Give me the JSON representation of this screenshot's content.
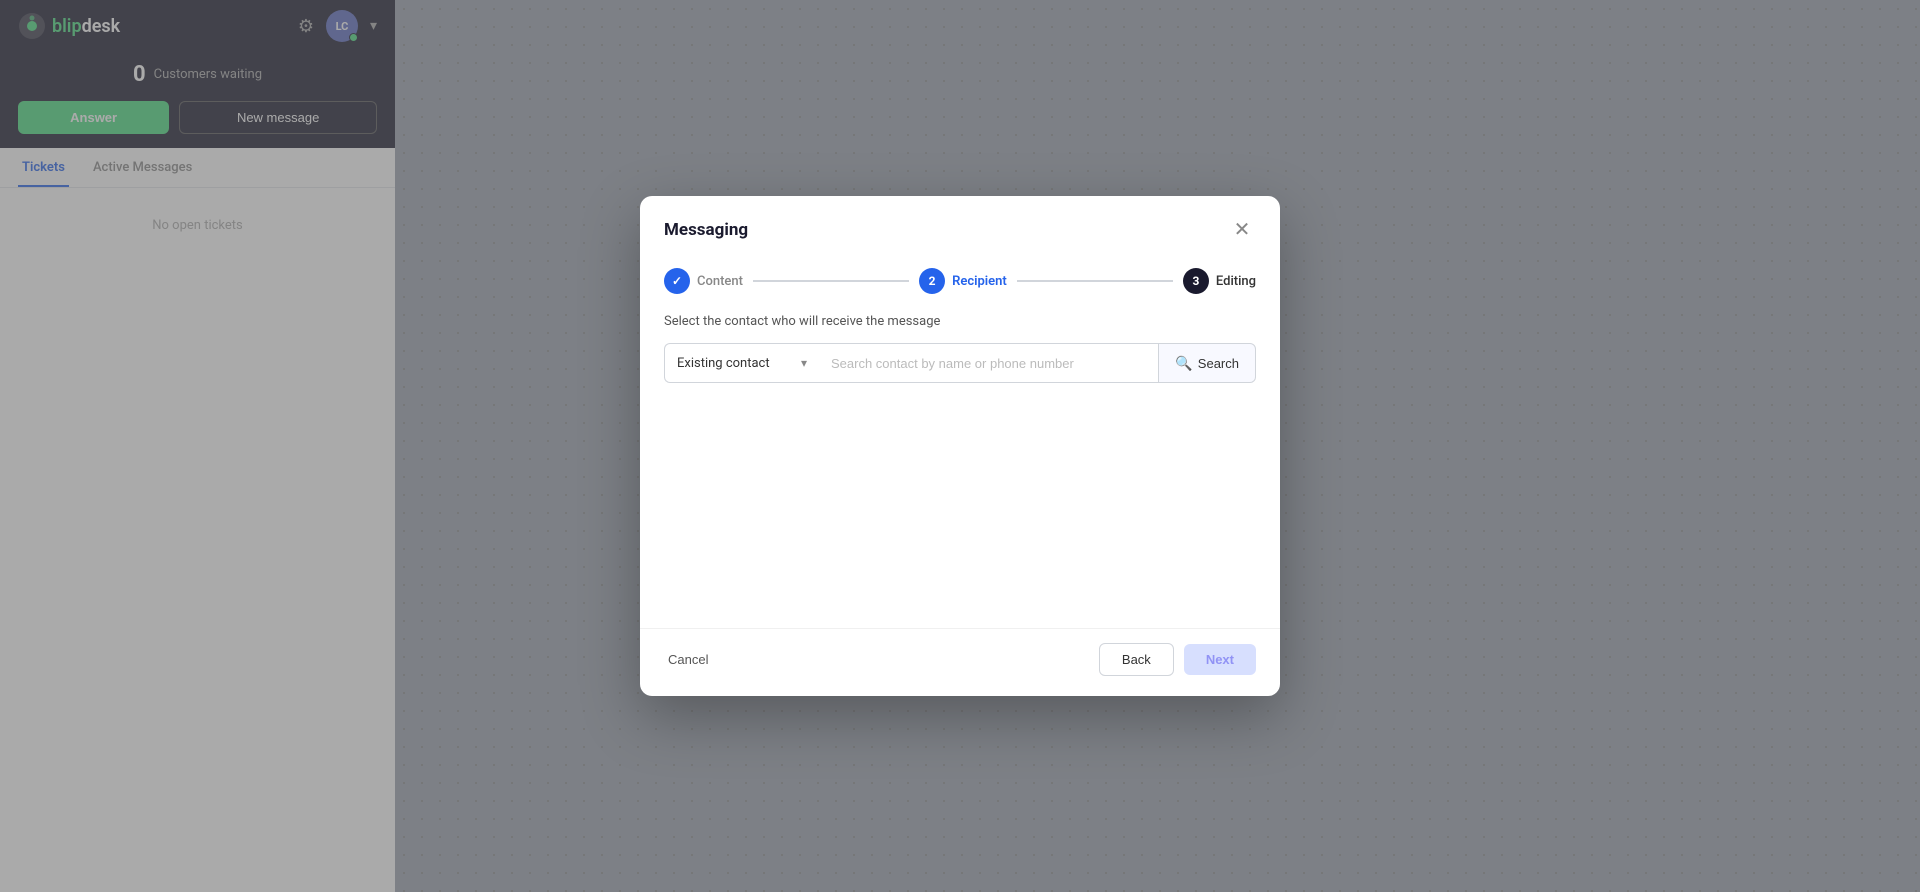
{
  "app": {
    "logo_text_1": "blip",
    "logo_text_2": "desk"
  },
  "header": {
    "avatar_initials": "LC",
    "gear_label": "settings"
  },
  "sidebar": {
    "customers_waiting_count": "0",
    "customers_waiting_label": "Customers waiting",
    "answer_button": "Answer",
    "new_message_button": "New message",
    "tabs": [
      {
        "id": "tickets",
        "label": "Tickets",
        "active": true
      },
      {
        "id": "active-messages",
        "label": "Active Messages",
        "active": false
      }
    ],
    "no_tickets_text": "No open tickets"
  },
  "modal": {
    "title": "Messaging",
    "steps": [
      {
        "id": "content",
        "number": "✓",
        "label": "Content",
        "state": "done"
      },
      {
        "id": "recipient",
        "number": "2",
        "label": "Recipient",
        "state": "active"
      },
      {
        "id": "editing",
        "number": "3",
        "label": "Editing",
        "state": "pending"
      }
    ],
    "recipient_description": "Select the contact who will receive the message",
    "contact_type_label": "Existing contact",
    "search_placeholder": "Search contact by name or phone number",
    "search_button": "Search",
    "cancel_button": "Cancel",
    "back_button": "Back",
    "next_button": "Next"
  }
}
